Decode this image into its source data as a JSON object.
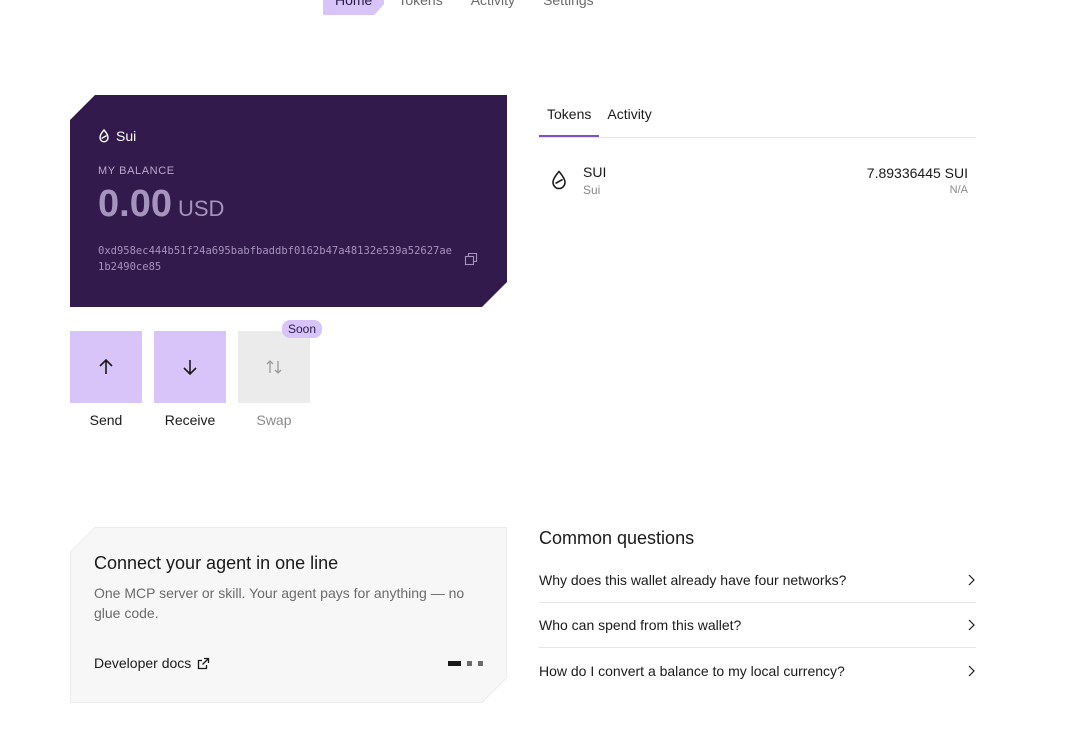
{
  "nav": {
    "tabs": [
      {
        "label": "Home"
      },
      {
        "label": "Tokens"
      },
      {
        "label": "Activity"
      },
      {
        "label": "Settings"
      }
    ]
  },
  "wallet": {
    "network": "Sui",
    "balance_label": "MY BALANCE",
    "balance_amount": "0.00",
    "balance_currency": "USD",
    "address": "0xd958ec444b51f24a695babfbaddbf0162b47a48132e539a52627ae1b2490ce85"
  },
  "actions": {
    "send": "Send",
    "receive": "Receive",
    "swap": "Swap",
    "swap_badge": "Soon"
  },
  "panel": {
    "tabs": [
      "Tokens",
      "Activity"
    ],
    "tokens": [
      {
        "symbol": "SUI",
        "name": "Sui",
        "amount": "7.89336445 SUI",
        "fiat": "N/A"
      }
    ]
  },
  "promo": {
    "title": "Connect your agent in one line",
    "body": "One MCP server or skill. Your agent pays for anything — no glue code.",
    "link": "Developer docs",
    "page": 1,
    "pages": 3
  },
  "faq": {
    "title": "Common questions",
    "items": [
      "Why does this wallet already have four networks?",
      "Who can spend from this wallet?",
      "How do I convert a balance to my local currency?"
    ]
  },
  "colors": {
    "card_bg": "#331a4d",
    "accent": "#d8c4f8",
    "tab_underline": "#7d4fc9"
  }
}
